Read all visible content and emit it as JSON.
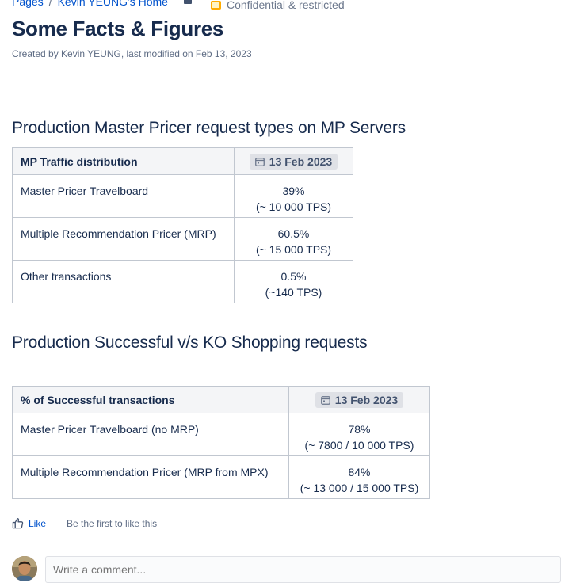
{
  "breadcrumb": {
    "items": [
      "Pages",
      "Kevin YEUNG's Home"
    ],
    "separator": "/"
  },
  "classification": {
    "label": "Confidential & restricted",
    "color": "#ffab00"
  },
  "page": {
    "title": "Some Facts & Figures",
    "byline": "Created by Kevin YEUNG, last modified on Feb 13, 2023"
  },
  "section1": {
    "heading": "Production Master Pricer request types on MP Servers",
    "table": {
      "header": {
        "label": "MP Traffic distribution",
        "date": "13 Feb 2023"
      },
      "rows": [
        {
          "label": "Master Pricer Travelboard",
          "pct": "39%",
          "tps": "(~ 10 000 TPS)"
        },
        {
          "label": "Multiple Recommendation Pricer (MRP)",
          "pct": "60.5%",
          "tps": "(~ 15 000 TPS)"
        },
        {
          "label": "Other transactions",
          "pct": "0.5%",
          "tps": "(~140 TPS)"
        }
      ]
    }
  },
  "section2": {
    "heading": "Production Successful v/s KO Shopping requests",
    "table": {
      "header": {
        "label": "% of Successful transactions",
        "date": "13 Feb 2023"
      },
      "rows": [
        {
          "label": "Master Pricer Travelboard (no MRP)",
          "pct": "78%",
          "tps": "(~ 7800 / 10 000 TPS)"
        },
        {
          "label": "Multiple Recommendation Pricer (MRP from MPX)",
          "pct": "84%",
          "tps": "(~ 13 000 / 15 000 TPS)"
        }
      ]
    }
  },
  "likes": {
    "button": "Like",
    "hint": "Be the first to like this"
  },
  "comment": {
    "placeholder": "Write a comment..."
  },
  "icons": {
    "lock": "lock-icon",
    "classification": "classification-icon",
    "calendar": "calendar-icon",
    "like": "thumbs-up-icon"
  },
  "colors": {
    "link": "#0052cc",
    "text": "#172b4d",
    "header_bg": "#f4f5f7"
  }
}
